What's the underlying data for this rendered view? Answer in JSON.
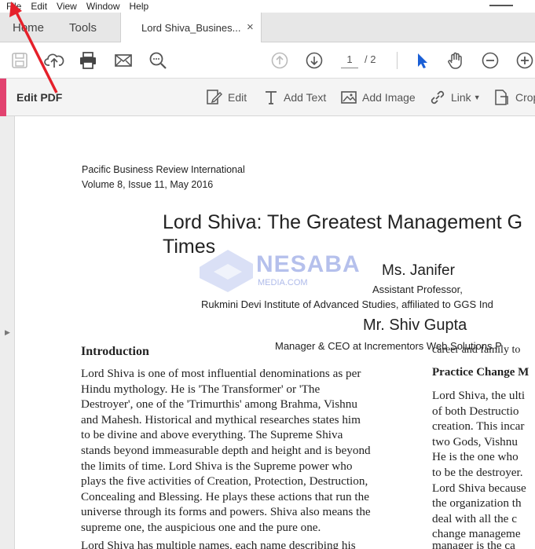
{
  "menu": [
    "File",
    "Edit",
    "View",
    "Window",
    "Help"
  ],
  "tabs": {
    "home": "Home",
    "tools": "Tools",
    "document": "Lord Shiva_Busines...",
    "close": "×"
  },
  "toolbar": {
    "current_page": "1",
    "total_pages": "/ 2"
  },
  "edit_bar": {
    "title": "Edit PDF",
    "tools": [
      "Edit",
      "Add Text",
      "Add Image",
      "Link",
      "Crop"
    ]
  },
  "page": {
    "journal_line1": "Pacific Business Review International",
    "journal_line2": "Volume 8, Issue 11, May 2016",
    "title_line1": "Lord Shiva: The Greatest Management G",
    "title_line2": "Times",
    "author1": "Ms. Janifer",
    "author1_role": "Assistant Professor,",
    "institute": "Rukmini Devi Institute of Advanced Studies, affiliated to GGS Ind",
    "author2": "Mr. Shiv Gupta",
    "author2_role": "Manager & CEO at Incrementors Web Solutions P",
    "right_fragment": "career and family to",
    "intro_heading": "Introduction",
    "intro_lines": [
      "Lord Shiva is one of most influential denominations as per",
      "Hindu mythology. He is 'The Transformer' or 'The",
      "Destroyer', one of the 'Trimurthis' among Brahma, Vishnu",
      "and Mahesh. Historical and mythical researches states him",
      "to be divine and above everything. The Supreme Shiva",
      "stands beyond immeasurable depth and height and is beyond",
      "the limits of time. Lord Shiva is the Supreme power who",
      "plays the five activities of Creation, Protection, Destruction,",
      "Concealing and Blessing. He plays these actions that run the",
      "universe through its forms and powers. Shiva also means the",
      "supreme one, the auspicious one and the pure one."
    ],
    "intro_next": "Lord Shiva has multiple names, each name describing his",
    "practice_heading": "Practice Change M",
    "practice_lines": [
      "Lord Shiva, the ulti",
      "of both Destructio",
      "creation. This incar",
      "two Gods, Vishnu",
      "He is the one who",
      "to be the destroyer.",
      "Lord Shiva because",
      "the organization th",
      "deal with all the c",
      "change manageme",
      "manager is the ca"
    ]
  },
  "watermark": {
    "word": "NESABA",
    "sub": "MEDIA.COM"
  },
  "colors": {
    "accent": "#e2426f",
    "arrow": "#e5202a",
    "cursor": "#1a5fd6"
  }
}
